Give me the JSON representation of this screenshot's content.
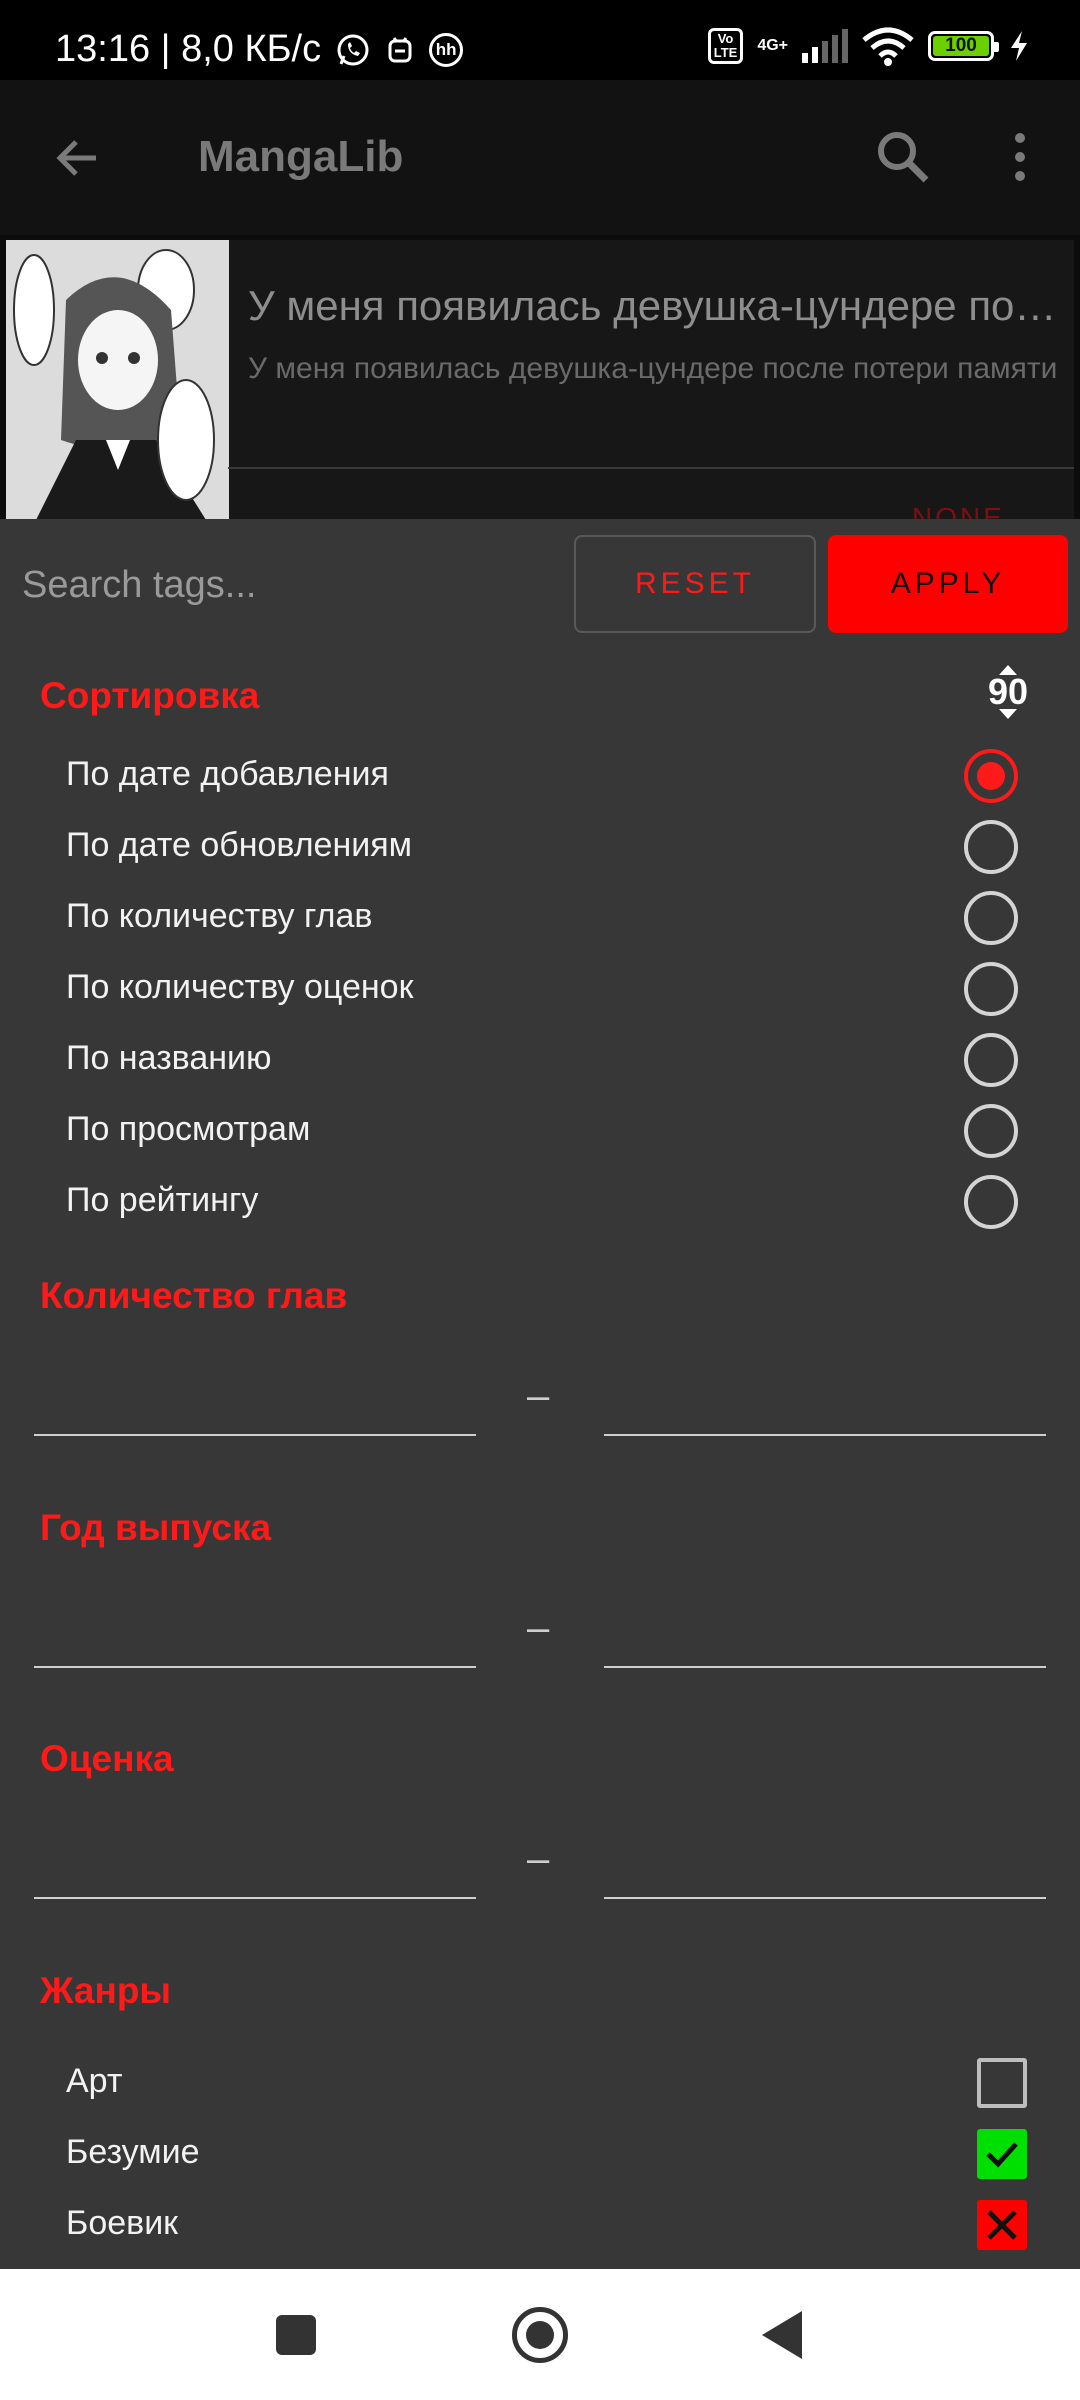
{
  "status_bar": {
    "time_speed": "13:16 | 8,0 КБ/с",
    "hh_icon": "hh",
    "volte": "Vo\nLTE",
    "network": "4G+",
    "battery": "100",
    "battery_level": 1.0
  },
  "app_bar": {
    "title": "MangaLib"
  },
  "manga": {
    "title": "У меня появилась девушка-цундере после потери памяти",
    "subtitle": "У меня появилась девушка-цундере после потери памяти",
    "status": "NONE"
  },
  "filter": {
    "search_placeholder": "Search tags...",
    "reset_label": "RESET",
    "apply_label": "APPLY",
    "sort": {
      "title": "Сортировка",
      "direction_value": "90",
      "options": [
        {
          "label": "По дате добавления",
          "selected": true
        },
        {
          "label": "По дате обновлениям",
          "selected": false
        },
        {
          "label": "По количеству глав",
          "selected": false
        },
        {
          "label": "По количеству оценок",
          "selected": false
        },
        {
          "label": "По названию",
          "selected": false
        },
        {
          "label": "По просмотрам",
          "selected": false
        },
        {
          "label": "По рейтингу",
          "selected": false
        }
      ]
    },
    "chapters": {
      "title": "Количество глав",
      "from": "",
      "to": "",
      "dash": "–"
    },
    "year": {
      "title": "Год выпуска",
      "from": "",
      "to": "",
      "dash": "–"
    },
    "rating": {
      "title": "Оценка",
      "from": "",
      "to": "",
      "dash": "–"
    },
    "genres": {
      "title": "Жанры",
      "items": [
        {
          "label": "Арт",
          "state": "none"
        },
        {
          "label": "Безумие",
          "state": "include"
        },
        {
          "label": "Боевик",
          "state": "exclude"
        }
      ]
    }
  },
  "colors": {
    "accent": "#ff1a1a",
    "sheet_bg": "#373737",
    "include": "#00e000",
    "exclude": "#ff0000"
  }
}
